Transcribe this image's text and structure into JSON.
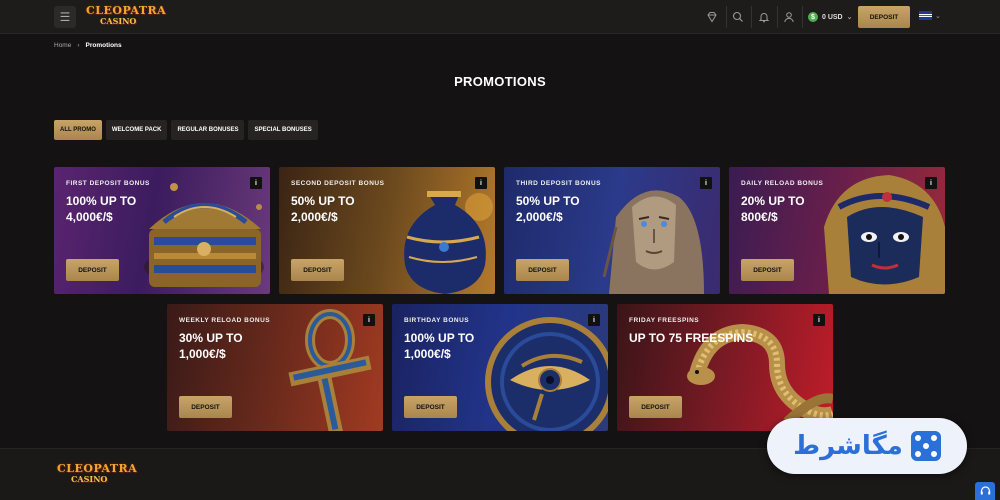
{
  "header": {
    "logo_line1": "CLEOPATRA",
    "logo_line2": "CASINO",
    "balance": "0 USD",
    "deposit_label": "DEPOSIT"
  },
  "breadcrumb": {
    "home": "Home",
    "current": "Promotions"
  },
  "page_title": "PROMOTIONS",
  "tabs": [
    "ALL PROMO",
    "WELCOME PACK",
    "REGULAR BONUSES",
    "SPECIAL BONUSES"
  ],
  "cards": [
    {
      "label": "FIRST DEPOSIT BONUS",
      "line1": "100% UP TO",
      "line2": "4,000€/$",
      "button": "DEPOSIT"
    },
    {
      "label": "SECOND DEPOSIT BONUS",
      "line1": "50% UP TO",
      "line2": "2,000€/$",
      "button": "DEPOSIT"
    },
    {
      "label": "THIRD DEPOSIT BONUS",
      "line1": "50% UP TO",
      "line2": "2,000€/$",
      "button": "DEPOSIT"
    },
    {
      "label": "DAILY RELOAD BONUS",
      "line1": "20% UP TO",
      "line2": "800€/$",
      "button": "DEPOSIT"
    },
    {
      "label": "WEEKLY RELOAD BONUS",
      "line1": "30% UP TO",
      "line2": "1,000€/$",
      "button": "DEPOSIT"
    },
    {
      "label": "BIRTHDAY BONUS",
      "line1": "100% UP TO",
      "line2": "1,000€/$",
      "button": "DEPOSIT"
    },
    {
      "label": "FRIDAY FREESPINS",
      "line1": "UP TO 75 FREESPINS",
      "line2": "",
      "button": "DEPOSIT"
    }
  ],
  "info_glyph": "i",
  "watermark_text": "مگاشرط",
  "colors": {
    "gold": "#c8a468",
    "background": "#141212",
    "topbar": "#1e1c1b"
  },
  "icons": [
    "menu-icon",
    "diamond-icon",
    "search-icon",
    "bell-icon",
    "user-icon",
    "dollar-icon",
    "chevron-down-icon",
    "uk-flag-icon",
    "info-icon",
    "headset-icon"
  ]
}
